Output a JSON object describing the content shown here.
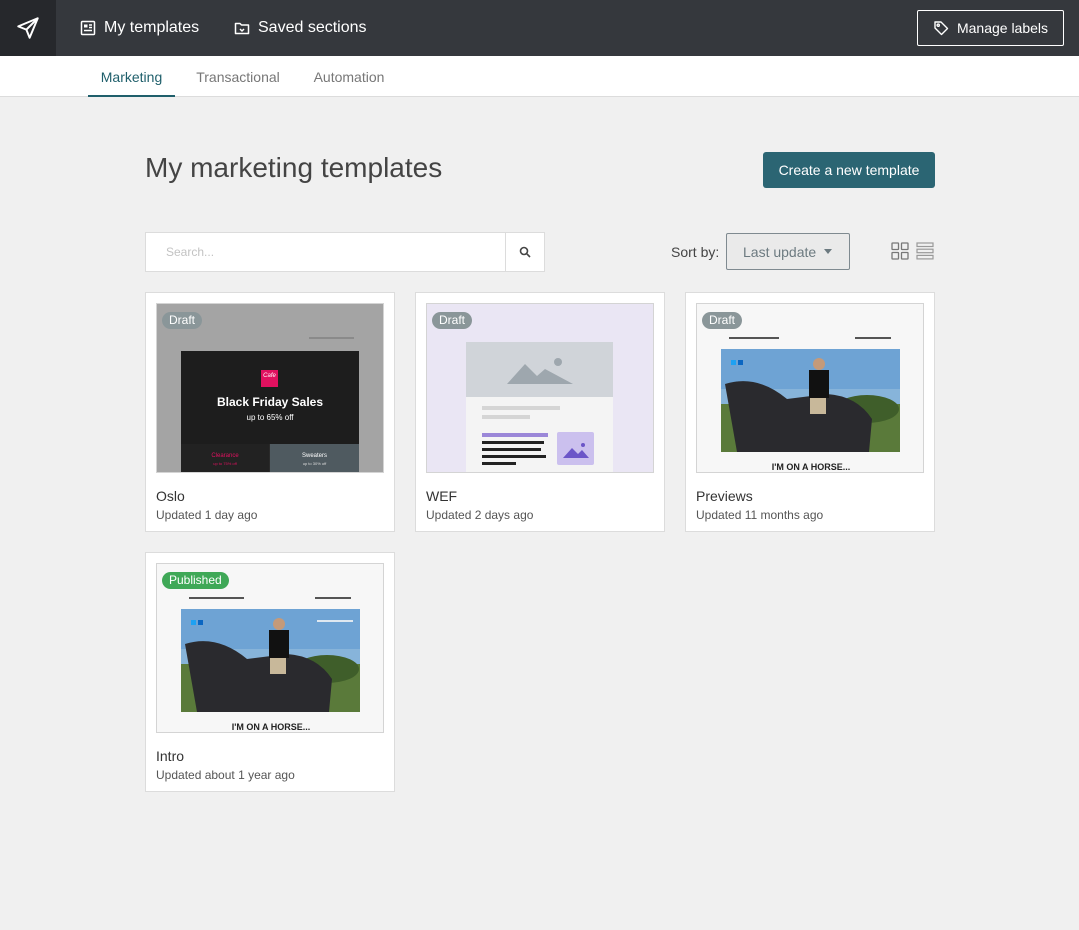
{
  "topbar": {
    "my_templates": "My templates",
    "saved_sections": "Saved sections",
    "manage_labels": "Manage labels"
  },
  "tabs": [
    {
      "label": "Marketing",
      "active": true
    },
    {
      "label": "Transactional",
      "active": false
    },
    {
      "label": "Automation",
      "active": false
    }
  ],
  "main": {
    "title": "My marketing templates",
    "create_button": "Create a new template"
  },
  "search": {
    "placeholder": "Search..."
  },
  "sort": {
    "label": "Sort by:",
    "value": "Last update"
  },
  "colors": {
    "accent": "#2b6573",
    "topbar": "#35383d",
    "draft_badge": "#8a9699",
    "published_badge": "#3fa857"
  },
  "templates": [
    {
      "name": "Oslo",
      "updated": "Updated 1 day ago",
      "status": "Draft",
      "preview": {
        "headline": "Black Friday Sales",
        "subline": "up to 65% off",
        "logo": "Cafe",
        "left_block": "Clearance",
        "left_sub": "up to 75% off",
        "right_block": "Sweaters",
        "right_sub": "up to 30% off"
      }
    },
    {
      "name": "WEF",
      "updated": "Updated 2 days ago",
      "status": "Draft"
    },
    {
      "name": "Previews",
      "updated": "Updated 11 months ago",
      "status": "Draft",
      "preview": {
        "caption": "I'M ON A HORSE..."
      }
    },
    {
      "name": "Intro",
      "updated": "Updated about 1 year ago",
      "status": "Published",
      "preview": {
        "caption": "I'M ON A HORSE..."
      }
    }
  ]
}
